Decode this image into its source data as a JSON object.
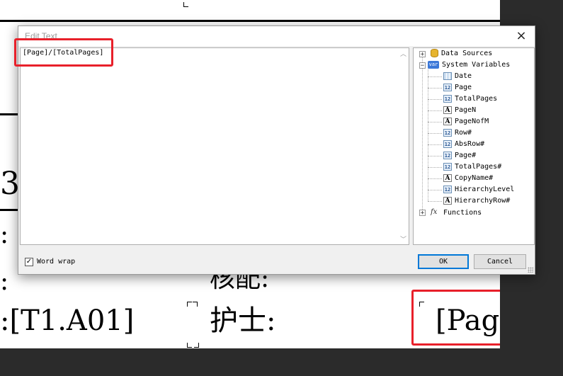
{
  "dialog": {
    "title": "Edit Text",
    "close_glyph": "×",
    "editor_text": "[Page]/[TotalPages]",
    "word_wrap_label": "Word wrap",
    "word_wrap_checked": true,
    "ok_label": "OK",
    "cancel_label": "Cancel"
  },
  "tree": {
    "data_sources": "Data Sources",
    "system_variables": "System Variables",
    "functions": "Functions",
    "variables": [
      {
        "name": "Date",
        "icon": "calendar-grid-icon"
      },
      {
        "name": "Page",
        "icon": "number-12-icon"
      },
      {
        "name": "TotalPages",
        "icon": "number-12-icon"
      },
      {
        "name": "PageN",
        "icon": "text-a-icon"
      },
      {
        "name": "PageNofM",
        "icon": "text-a-icon"
      },
      {
        "name": "Row#",
        "icon": "number-12-icon"
      },
      {
        "name": "AbsRow#",
        "icon": "number-12-icon"
      },
      {
        "name": "Page#",
        "icon": "number-12-icon"
      },
      {
        "name": "TotalPages#",
        "icon": "number-12-icon"
      },
      {
        "name": "CopyName#",
        "icon": "text-a-icon"
      },
      {
        "name": "HierarchyLevel",
        "icon": "number-12-icon"
      },
      {
        "name": "HierarchyRow#",
        "icon": "text-a-icon"
      }
    ]
  },
  "background": {
    "big_digit": "3",
    "colon1": ":",
    "colon2": ":",
    "t1_field": ":[T1.A01]",
    "check_label": "核配:",
    "nurse_label": "护士:",
    "page_field": "[Pag"
  },
  "colors": {
    "highlight": "#e8202a",
    "ok_border": "#0078d7",
    "background_dark": "#2b2b2b"
  }
}
